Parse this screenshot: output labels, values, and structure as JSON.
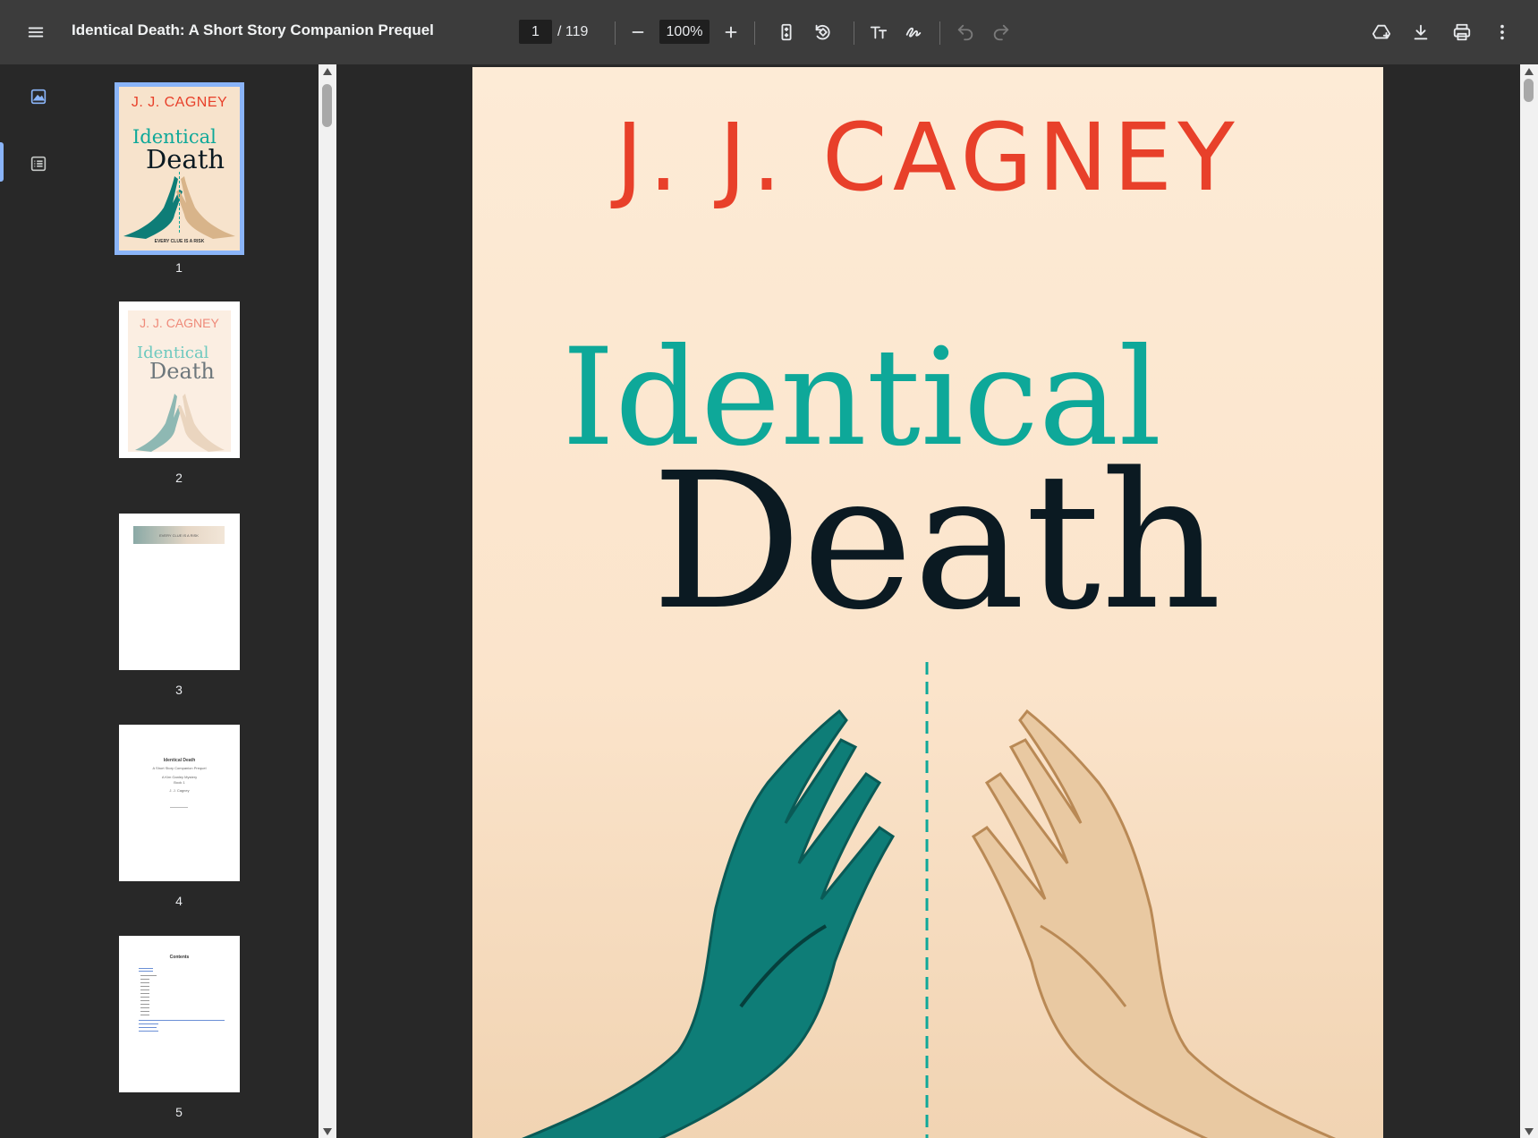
{
  "toolbar": {
    "menu_icon": "hamburger-menu-icon",
    "title": "Identical Death: A Short Story Companion Prequel",
    "current_page": "1",
    "total_pages": "/ 119",
    "zoom": "100%",
    "icons": [
      "zoom-out-icon",
      "zoom-in-icon",
      "fit-page-icon",
      "rotate-icon",
      "text-annotation-icon",
      "draw-icon",
      "undo-icon",
      "redo-icon",
      "drive-save-icon",
      "download-icon",
      "print-icon",
      "more-vert-icon"
    ]
  },
  "sidebar": {
    "thumbnails_icon": "thumbnails-icon",
    "outline_icon": "outline-icon",
    "thumbnails": [
      {
        "label": "1"
      },
      {
        "label": "2"
      },
      {
        "label": "3"
      },
      {
        "label": "4"
      },
      {
        "label": "5"
      }
    ],
    "thumb_text": {
      "cover_author": "J. J. CAGNEY",
      "cover_title_1": "Identical",
      "cover_title_2": "Death",
      "cover_tagline": "EVERY CLUE IS A RISK",
      "p4_title": "Identical Death",
      "p4_sub": "A Short Story Companion Prequel",
      "p4_series": "A Kim Ganley Mystery",
      "p4_book": "Book 1",
      "p4_author": "J. J. Cagney",
      "p5_title": "Contents"
    }
  },
  "cover": {
    "author": "J. J. CAGNEY",
    "title_line1": "Identical",
    "title_line2": "Death",
    "colors": {
      "author": "#e8402a",
      "identical": "#0ea899",
      "death": "#0b1a22",
      "hand_left": "#0e7d77",
      "hand_right": "#c99a68",
      "background": "#fdebd6"
    }
  }
}
